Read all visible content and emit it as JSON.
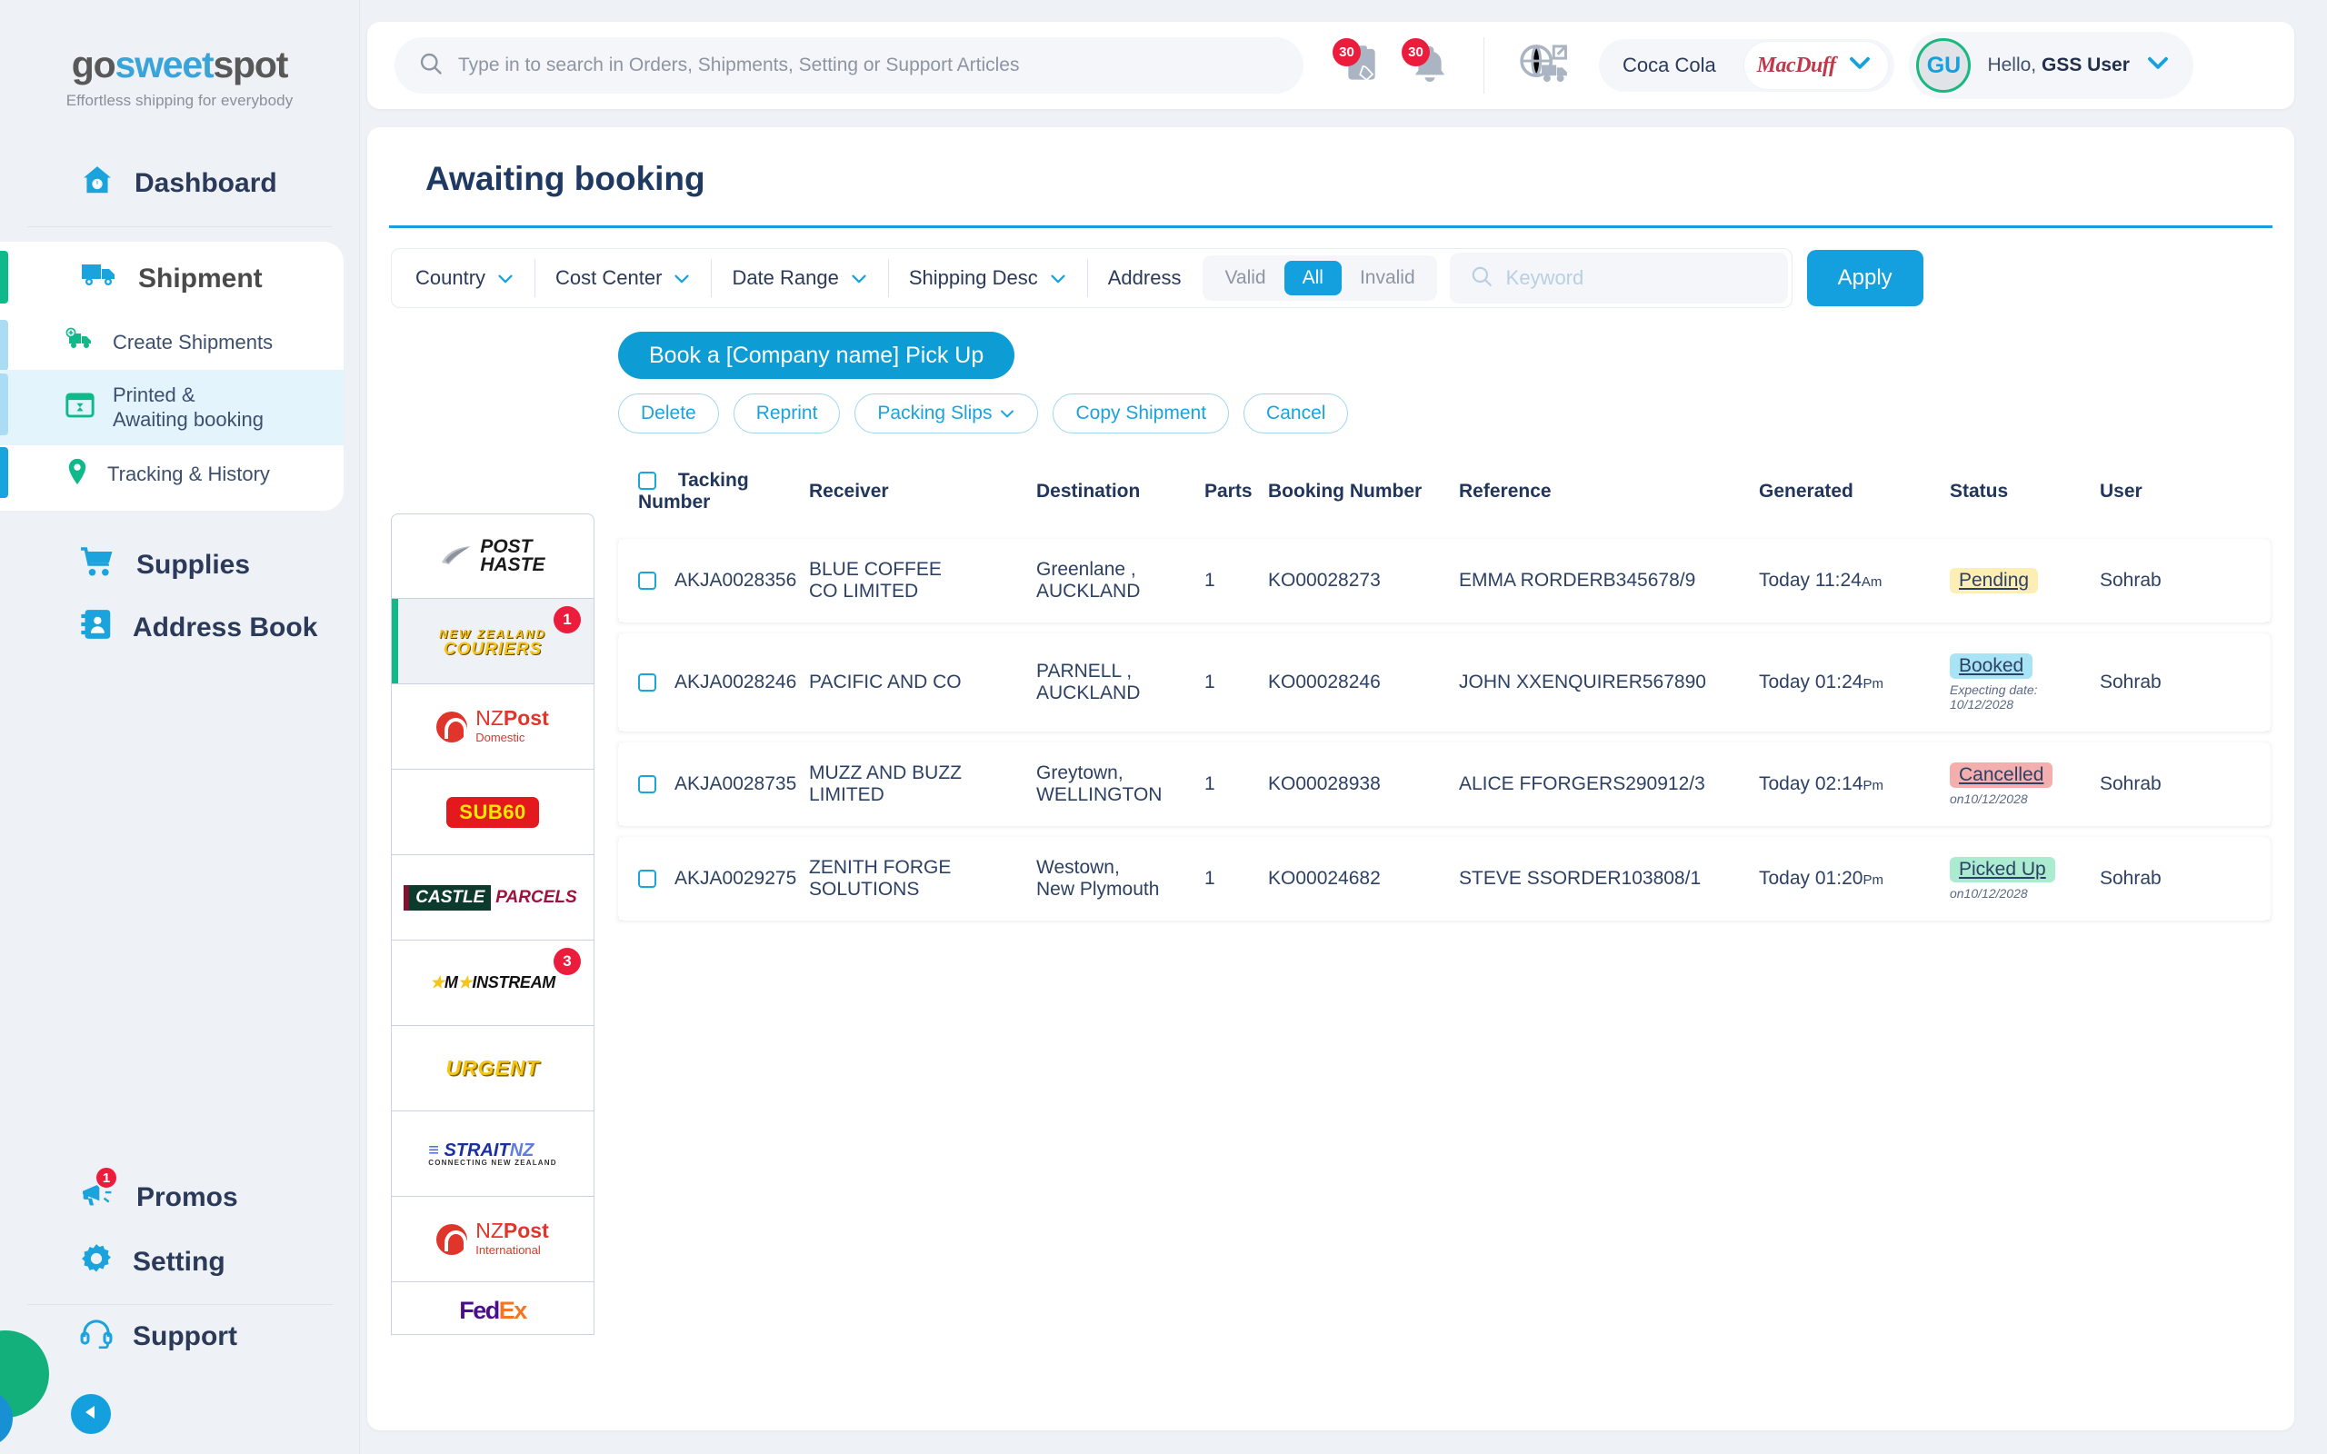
{
  "brand": {
    "part1": "go",
    "part2": "sweet",
    "part3": "spot",
    "tagline": "Effortless shipping for everybody"
  },
  "sidebar": {
    "dashboard": "Dashboard",
    "shipment": "Shipment",
    "sub_items": [
      {
        "label": "Create Shipments",
        "icon": "truck-plus-icon"
      },
      {
        "label": "Printed &\nAwaiting booking",
        "label_l1": "Printed &",
        "label_l2": "Awaiting booking",
        "icon": "calendar-clock-icon"
      },
      {
        "label": "Tracking & History",
        "icon": "map-pin-icon"
      }
    ],
    "supplies": "Supplies",
    "address_book": "Address Book",
    "promos": "Promos",
    "promos_badge": "1",
    "setting": "Setting",
    "support": "Support"
  },
  "topbar": {
    "search_placeholder": "Type in to search in Orders, Shipments, Setting or Support Articles",
    "search_value": "",
    "orders_badge": "30",
    "bell_badge": "30",
    "account_name": "Coca Cola",
    "account_logo_text": "MacDuff",
    "avatar_initials": "GU",
    "greeting_prefix": "Hello,",
    "user_name": "GSS User"
  },
  "page": {
    "title": "Awaiting booking"
  },
  "filters": {
    "country": "Country",
    "cost_center": "Cost Center",
    "date_range": "Date Range",
    "shipping_desc": "Shipping Desc",
    "address_label": "Address",
    "segments": [
      {
        "label": "Valid",
        "selected": false
      },
      {
        "label": "All",
        "selected": true
      },
      {
        "label": "Invalid",
        "selected": false
      }
    ],
    "keyword_placeholder": "Keyword",
    "keyword_value": "",
    "apply": "Apply"
  },
  "actions": {
    "primary": "Book a [Company name] Pick Up",
    "delete": "Delete",
    "reprint": "Reprint",
    "packing_slips": "Packing Slips",
    "copy_shipment": "Copy Shipment",
    "cancel": "Cancel"
  },
  "carriers": [
    {
      "name": "Post Haste",
      "badge": "",
      "selected": false,
      "logo": "posthaste"
    },
    {
      "name": "New Zealand Couriers",
      "badge": "1",
      "selected": true,
      "logo": "nzcouriers"
    },
    {
      "name": "NZ Post Domestic",
      "badge": "",
      "selected": false,
      "logo": "nzpost-domestic",
      "sub": "Domestic"
    },
    {
      "name": "Sub60",
      "badge": "",
      "selected": false,
      "logo": "sub60"
    },
    {
      "name": "Castle Parcels",
      "badge": "",
      "selected": false,
      "logo": "castleparcels"
    },
    {
      "name": "Mainstream",
      "badge": "3",
      "selected": false,
      "logo": "mainstream"
    },
    {
      "name": "Urgent",
      "badge": "",
      "selected": false,
      "logo": "urgent"
    },
    {
      "name": "StraitNZ",
      "badge": "",
      "selected": false,
      "logo": "straitnz"
    },
    {
      "name": "NZ Post International",
      "badge": "",
      "selected": false,
      "logo": "nzpost-international",
      "sub": "International"
    },
    {
      "name": "FedEx",
      "badge": "",
      "selected": false,
      "logo": "fedex"
    }
  ],
  "table": {
    "columns": [
      "Tacking Number",
      "Receiver",
      "Destination",
      "Parts",
      "Booking Number",
      "Reference",
      "Generated",
      "Status",
      "User"
    ],
    "rows": [
      {
        "tracking": "AKJA0028356",
        "receiver_l1": "BLUE COFFEE",
        "receiver_l2": "CO LIMITED",
        "destination_l1": "Greenlane ,",
        "destination_l2": "AUCKLAND",
        "parts": "1",
        "booking": "KO00028273",
        "reference": "EMMA RORDERB345678/9",
        "generated": "Today 11:24",
        "generated_ampm": "Am",
        "status": "Pending",
        "status_kind": "pending",
        "status_note": "",
        "user": "Sohrab"
      },
      {
        "tracking": "AKJA0028246",
        "receiver_l1": "PACIFIC AND CO",
        "receiver_l2": "",
        "destination_l1": "PARNELL ,",
        "destination_l2": "AUCKLAND",
        "parts": "1",
        "booking": "KO00028246",
        "reference": "JOHN XXENQUIRER567890",
        "generated": "Today 01:24",
        "generated_ampm": "Pm",
        "status": "Booked",
        "status_kind": "booked",
        "status_note": "Expecting date:\n10/12/2028",
        "status_note_l1": "Expecting date:",
        "status_note_l2": "10/12/2028",
        "user": "Sohrab"
      },
      {
        "tracking": "AKJA0028735",
        "receiver_l1": "MUZZ AND BUZZ",
        "receiver_l2": "LIMITED",
        "destination_l1": "Greytown,",
        "destination_l2": "WELLINGTON",
        "parts": "1",
        "booking": "KO00028938",
        "reference": "ALICE FFORGERS290912/3",
        "generated": "Today 02:14",
        "generated_ampm": "Pm",
        "status": "Cancelled",
        "status_kind": "cancelled",
        "status_note_l1": "on10/12/2028",
        "status_note_l2": "",
        "user": "Sohrab"
      },
      {
        "tracking": "AKJA0029275",
        "receiver_l1": "ZENITH FORGE",
        "receiver_l2": "SOLUTIONS",
        "destination_l1": "Westown,",
        "destination_l2": "New Plymouth",
        "parts": "1",
        "booking": "KO00024682",
        "reference": "STEVE SSORDER103808/1",
        "generated": "Today 01:20",
        "generated_ampm": "Pm",
        "status": "Picked Up",
        "status_kind": "picked",
        "status_note_l1": "on10/12/2028",
        "status_note_l2": "",
        "user": "Sohrab"
      }
    ]
  },
  "colors": {
    "accent": "#14a0de",
    "green": "#0fb98a",
    "danger": "#ec1c3c",
    "title": "#1e3a63"
  }
}
